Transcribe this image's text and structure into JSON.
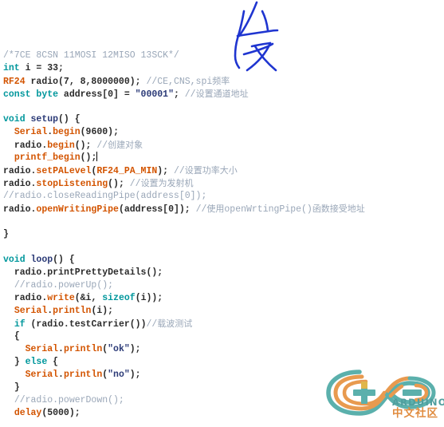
{
  "app": {
    "name": "arduino-ide-code-editor",
    "language": "cpp"
  },
  "annotation": {
    "character": "发",
    "color": "#1f35d0",
    "description": "handwritten-blue-chinese-character"
  },
  "watermark": {
    "brand": "ARDUINO",
    "community": "中文社区",
    "brand_color": "#4f9e9e",
    "community_color": "#e08b3e",
    "logo_teal": "#5bb0ac",
    "logo_orange": "#e89a4f"
  },
  "colors": {
    "background": "#ffffff",
    "keyword": "#00979c",
    "function": "#d35400",
    "function_name": "#2b3a77",
    "string": "#2b3a77",
    "comment": "#9aa7b8",
    "plain": "#2b2b2b"
  },
  "code": {
    "lines": [
      {
        "n": 1,
        "indent": 0,
        "text": "/*7CE 8CSN 11MOSI 12MISO 13SCK*/",
        "tokens": [
          {
            "t": "/*7CE 8CSN 11MOSI 12MISO 13SCK*/",
            "c": "cm"
          }
        ]
      },
      {
        "n": 2,
        "indent": 0,
        "text": "int i = 33;",
        "tokens": [
          {
            "t": "int",
            "c": "kw"
          },
          {
            "t": " i = 33;",
            "c": "nm"
          }
        ]
      },
      {
        "n": 3,
        "indent": 0,
        "text": "RF24 radio(7, 8,8000000); //CE,CNS,spi频率",
        "tokens": [
          {
            "t": "RF24",
            "c": "fn"
          },
          {
            "t": " radio(7, 8,8000000); ",
            "c": "nm"
          },
          {
            "t": "//CE,CNS,spi",
            "c": "cm"
          },
          {
            "t": "频率",
            "c": "cmz"
          }
        ]
      },
      {
        "n": 4,
        "indent": 0,
        "text": "const byte address[0] = \"00001\"; //设置通道地址",
        "tokens": [
          {
            "t": "const",
            "c": "kw"
          },
          {
            "t": " ",
            "c": "nm"
          },
          {
            "t": "byte",
            "c": "kw"
          },
          {
            "t": " address[0] = ",
            "c": "nm"
          },
          {
            "t": "\"00001\"",
            "c": "str"
          },
          {
            "t": "; ",
            "c": "nm"
          },
          {
            "t": "//",
            "c": "cm"
          },
          {
            "t": "设置通道地址",
            "c": "cmz"
          }
        ]
      },
      {
        "n": 5,
        "indent": 0,
        "text": "",
        "tokens": []
      },
      {
        "n": 6,
        "indent": 0,
        "text": "void setup() {",
        "tokens": [
          {
            "t": "void",
            "c": "kw"
          },
          {
            "t": " ",
            "c": "nm"
          },
          {
            "t": "setup",
            "c": "fname"
          },
          {
            "t": "() {",
            "c": "nm"
          }
        ]
      },
      {
        "n": 7,
        "indent": 1,
        "text": "Serial.begin(9600);",
        "tokens": [
          {
            "t": "Serial",
            "c": "fn"
          },
          {
            "t": ".",
            "c": "nm"
          },
          {
            "t": "begin",
            "c": "fn"
          },
          {
            "t": "(9600);",
            "c": "nm"
          }
        ]
      },
      {
        "n": 8,
        "indent": 1,
        "text": "radio.begin(); //创建对象",
        "tokens": [
          {
            "t": "radio.",
            "c": "nm"
          },
          {
            "t": "begin",
            "c": "fn"
          },
          {
            "t": "(); ",
            "c": "nm"
          },
          {
            "t": "//",
            "c": "cm"
          },
          {
            "t": "创建对象",
            "c": "cmz"
          }
        ]
      },
      {
        "n": 9,
        "indent": 1,
        "text": "printf_begin();",
        "caret": true,
        "tokens": [
          {
            "t": "printf_begin",
            "c": "fn"
          },
          {
            "t": "();",
            "c": "nm"
          }
        ]
      },
      {
        "n": 10,
        "indent": 0,
        "text": "radio.setPALevel(RF24_PA_MIN); //设置功率大小",
        "tokens": [
          {
            "t": "radio.",
            "c": "nm"
          },
          {
            "t": "setPALevel",
            "c": "fn"
          },
          {
            "t": "(",
            "c": "nm"
          },
          {
            "t": "RF24_PA_MIN",
            "c": "fn"
          },
          {
            "t": "); ",
            "c": "nm"
          },
          {
            "t": "//",
            "c": "cm"
          },
          {
            "t": "设置功率大小",
            "c": "cmz"
          }
        ]
      },
      {
        "n": 11,
        "indent": 0,
        "text": "radio.stopListening(); //设置为发射机",
        "tokens": [
          {
            "t": "radio.",
            "c": "nm"
          },
          {
            "t": "stopListening",
            "c": "fn"
          },
          {
            "t": "(); ",
            "c": "nm"
          },
          {
            "t": "//",
            "c": "cm"
          },
          {
            "t": "设置为发射机",
            "c": "cmz"
          }
        ]
      },
      {
        "n": 12,
        "indent": 0,
        "text": "//radio.closeReadingPipe(address[0]);",
        "tokens": [
          {
            "t": "//radio.closeReadingPipe(address[0]);",
            "c": "cm"
          }
        ]
      },
      {
        "n": 13,
        "indent": 0,
        "text": "radio.openWritingPipe(address[0]); //使用openWrtingPipe()函数接受地址",
        "tokens": [
          {
            "t": "radio.",
            "c": "nm"
          },
          {
            "t": "openWritingPipe",
            "c": "fn"
          },
          {
            "t": "(address[0]); ",
            "c": "nm"
          },
          {
            "t": "//",
            "c": "cm"
          },
          {
            "t": "使用",
            "c": "cmz"
          },
          {
            "t": "openWrtingPipe()",
            "c": "cm"
          },
          {
            "t": "函数接受地址",
            "c": "cmz"
          }
        ]
      },
      {
        "n": 14,
        "indent": 0,
        "text": "",
        "tokens": []
      },
      {
        "n": 15,
        "indent": 0,
        "text": "}",
        "tokens": [
          {
            "t": "}",
            "c": "nm"
          }
        ]
      },
      {
        "n": 16,
        "indent": 0,
        "text": "",
        "tokens": []
      },
      {
        "n": 17,
        "indent": 0,
        "text": "void loop() {",
        "tokens": [
          {
            "t": "void",
            "c": "kw"
          },
          {
            "t": " ",
            "c": "nm"
          },
          {
            "t": "loop",
            "c": "fname"
          },
          {
            "t": "() {",
            "c": "nm"
          }
        ]
      },
      {
        "n": 18,
        "indent": 1,
        "text": "radio.printPrettyDetails();",
        "tokens": [
          {
            "t": "radio.",
            "c": "nm"
          },
          {
            "t": "printPrettyDetails",
            "c": "nm"
          },
          {
            "t": "();",
            "c": "nm"
          }
        ]
      },
      {
        "n": 19,
        "indent": 1,
        "text": "//radio.powerUp();",
        "tokens": [
          {
            "t": "//radio.powerUp();",
            "c": "cm"
          }
        ]
      },
      {
        "n": 20,
        "indent": 1,
        "text": "radio.write(&i, sizeof(i));",
        "tokens": [
          {
            "t": "radio.",
            "c": "nm"
          },
          {
            "t": "write",
            "c": "fn"
          },
          {
            "t": "(&i, ",
            "c": "nm"
          },
          {
            "t": "sizeof",
            "c": "kw"
          },
          {
            "t": "(i));",
            "c": "nm"
          }
        ]
      },
      {
        "n": 21,
        "indent": 1,
        "text": "Serial.println(i);",
        "tokens": [
          {
            "t": "Serial",
            "c": "fn"
          },
          {
            "t": ".",
            "c": "nm"
          },
          {
            "t": "println",
            "c": "fn"
          },
          {
            "t": "(i);",
            "c": "nm"
          }
        ]
      },
      {
        "n": 22,
        "indent": 1,
        "text": "if (radio.testCarrier())//载波测试",
        "tokens": [
          {
            "t": "if",
            "c": "kw"
          },
          {
            "t": " (radio.",
            "c": "nm"
          },
          {
            "t": "testCarrier",
            "c": "nm"
          },
          {
            "t": "())",
            "c": "nm"
          },
          {
            "t": "//",
            "c": "cm"
          },
          {
            "t": "载波测试",
            "c": "cmz"
          }
        ]
      },
      {
        "n": 23,
        "indent": 1,
        "text": "{",
        "tokens": [
          {
            "t": "{",
            "c": "nm"
          }
        ]
      },
      {
        "n": 24,
        "indent": 2,
        "text": "Serial.println(\"ok\");",
        "tokens": [
          {
            "t": "Serial",
            "c": "fn"
          },
          {
            "t": ".",
            "c": "nm"
          },
          {
            "t": "println",
            "c": "fn"
          },
          {
            "t": "(",
            "c": "nm"
          },
          {
            "t": "\"ok\"",
            "c": "str"
          },
          {
            "t": ");",
            "c": "nm"
          }
        ]
      },
      {
        "n": 25,
        "indent": 1,
        "text": "} else {",
        "tokens": [
          {
            "t": "} ",
            "c": "nm"
          },
          {
            "t": "else",
            "c": "kw"
          },
          {
            "t": " {",
            "c": "nm"
          }
        ]
      },
      {
        "n": 26,
        "indent": 2,
        "text": "Serial.println(\"no\");",
        "tokens": [
          {
            "t": "Serial",
            "c": "fn"
          },
          {
            "t": ".",
            "c": "nm"
          },
          {
            "t": "println",
            "c": "fn"
          },
          {
            "t": "(",
            "c": "nm"
          },
          {
            "t": "\"no\"",
            "c": "str"
          },
          {
            "t": ");",
            "c": "nm"
          }
        ]
      },
      {
        "n": 27,
        "indent": 1,
        "text": "}",
        "tokens": [
          {
            "t": "}",
            "c": "nm"
          }
        ]
      },
      {
        "n": 28,
        "indent": 1,
        "text": "//radio.powerDown();",
        "tokens": [
          {
            "t": "//radio.powerDown();",
            "c": "cm"
          }
        ]
      },
      {
        "n": 29,
        "indent": 1,
        "text": "delay(5000);",
        "tokens": [
          {
            "t": "delay",
            "c": "fn"
          },
          {
            "t": "(5000);",
            "c": "nm"
          }
        ]
      }
    ]
  }
}
